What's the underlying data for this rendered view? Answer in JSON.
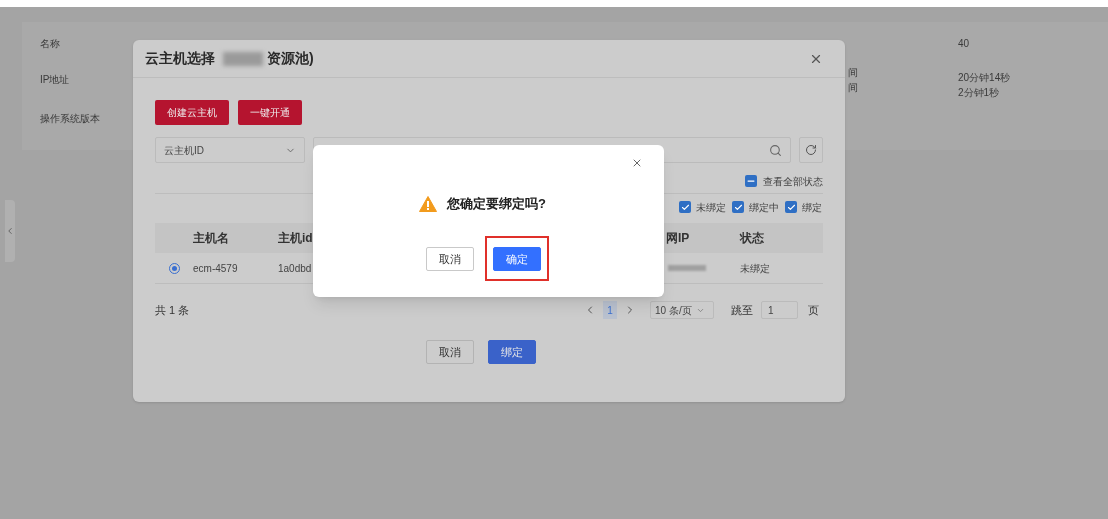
{
  "background": {
    "left_labels": [
      "名称",
      "IP地址",
      "操作系统版本"
    ],
    "right_labels": [
      {
        "label": "间"
      },
      {
        "label": "间"
      }
    ],
    "values": [
      "40",
      "20分钟14秒",
      "2分钟1秒"
    ]
  },
  "dialog": {
    "title": "云主机选择",
    "title_suffix": "资源池)",
    "actions": [
      "创建云主机",
      "一键开通"
    ],
    "filter": {
      "value": "云主机ID"
    },
    "view_all": {
      "label": "查看全部状态",
      "indeterminate": true
    },
    "status_filters": [
      {
        "label": "未绑定",
        "checked": true
      },
      {
        "label": "绑定中",
        "checked": true
      },
      {
        "label": "绑定",
        "checked": true
      }
    ],
    "columns": [
      "主机名",
      "主机id",
      "网IP",
      "状态"
    ],
    "rows": [
      {
        "selected": true,
        "name": "ecm-4579",
        "id": "1a0dbd",
        "status": "未绑定"
      }
    ],
    "total": "共 1 条",
    "pagination": {
      "pages": [
        {
          "label": "1",
          "selected": true
        }
      ],
      "page_size": "10 条/页",
      "jump_label": "跳至",
      "jump_value": "1",
      "jump_suffix": "页"
    },
    "buttons": [
      {
        "label": "取消",
        "kind": "default"
      },
      {
        "label": "绑定",
        "kind": "primary"
      }
    ]
  },
  "confirm": {
    "message": "您确定要绑定吗?",
    "buttons": [
      {
        "label": "取消",
        "kind": "default",
        "highlighted": false
      },
      {
        "label": "确定",
        "kind": "primary",
        "highlighted": true
      }
    ]
  }
}
